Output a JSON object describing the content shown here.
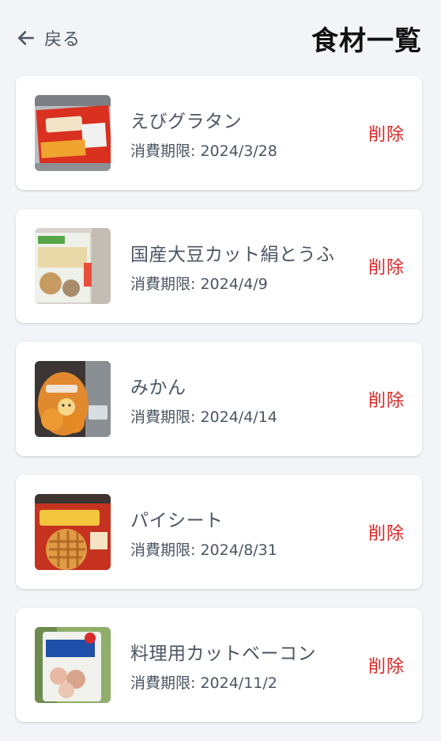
{
  "header": {
    "back_label": "戻る",
    "title": "食材一覧"
  },
  "items": [
    {
      "name": "えびグラタン",
      "expiry_label": "消費期限: 2024/3/28",
      "delete_label": "削除",
      "image_alt": "えびグラタン package photo"
    },
    {
      "name": "国産大豆カット絹とうふ",
      "expiry_label": "消費期限: 2024/4/9",
      "delete_label": "削除",
      "image_alt": "国産大豆カット絹とうふ package photo"
    },
    {
      "name": "みかん",
      "expiry_label": "消費期限: 2024/4/14",
      "delete_label": "削除",
      "image_alt": "みかん bag photo"
    },
    {
      "name": "パイシート",
      "expiry_label": "消費期限: 2024/8/31",
      "delete_label": "削除",
      "image_alt": "パイシート box photo"
    },
    {
      "name": "料理用カットベーコン",
      "expiry_label": "消費期限: 2024/11/2",
      "delete_label": "削除",
      "image_alt": "料理用カットベーコン package photo"
    }
  ],
  "colors": {
    "background": "#f2f4f7",
    "card": "#ffffff",
    "delete": "#dc2626",
    "text": "#4b5563",
    "title": "#111111"
  }
}
